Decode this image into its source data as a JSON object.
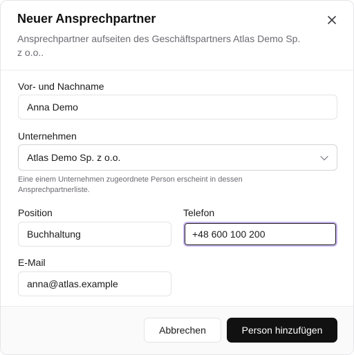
{
  "dialog": {
    "title": "Neuer Ansprechpartner",
    "description": "Ansprechpartner aufseiten des Geschäftspartners Atlas Demo Sp. z o.o..",
    "close_icon": "close-icon"
  },
  "form": {
    "name": {
      "label": "Vor- und Nachname",
      "value": "Anna Demo"
    },
    "company": {
      "label": "Unternehmen",
      "value": "Atlas Demo Sp. z o.o.",
      "hint": "Eine einem Unternehmen zugeordnete Person erscheint in dessen Ansprechpartnerliste."
    },
    "position": {
      "label": "Position",
      "value": "Buchhaltung"
    },
    "phone": {
      "label": "Telefon",
      "value": "+48 600 100 200"
    },
    "email": {
      "label": "E-Mail",
      "value": "anna@atlas.example"
    }
  },
  "footer": {
    "cancel_label": "Abbrechen",
    "submit_label": "Person hinzufügen"
  },
  "colors": {
    "primary": "#111111",
    "focus_ring": "#c9b6f0",
    "muted_text": "#6b6b72"
  }
}
